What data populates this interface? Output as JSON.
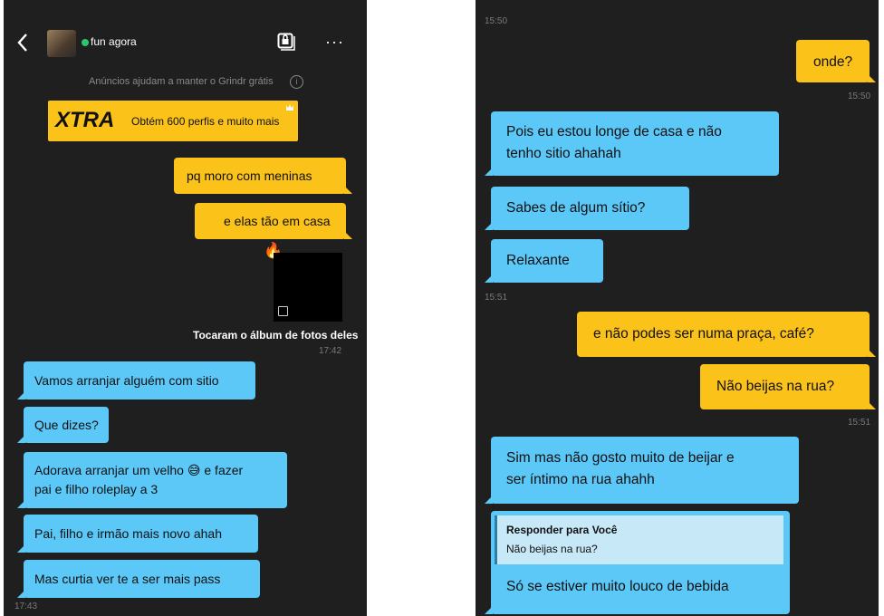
{
  "left": {
    "header": {
      "status": "fun agora"
    },
    "ad_notice": "Anúncios ajudam a manter o Grindr grátis",
    "ad_banner": {
      "brand": "XTRA",
      "text": "Obtém 600 perfis e muito mais"
    },
    "messages": [
      {
        "side": "out",
        "text": "pq moro com meninas"
      },
      {
        "side": "out",
        "text": "e elas tão em casa"
      }
    ],
    "reaction_emoji": "🔥",
    "album_caption": "Tocaram o álbum de fotos deles",
    "time_1": "17:42",
    "incoming": [
      {
        "text": "Vamos arranjar alguém com sitio"
      },
      {
        "text": "Que dizes?"
      },
      {
        "text_a": "Adorava arranjar um velho",
        "emoji": "😅",
        "text_b": "e fazer",
        "text_c": "pai e filho roleplay a 3"
      },
      {
        "text": "Pai, filho e irmão mais novo ahah"
      },
      {
        "text": "Mas curtia ver te a ser mais pass"
      }
    ],
    "time_2": "17:43"
  },
  "right": {
    "time_top": "15:50",
    "msg_onde": "onde?",
    "time_onde": "15:50",
    "in_1_line1": "Pois eu estou longe de casa e não",
    "in_1_line2": "tenho sitio ahahah",
    "in_2": "Sabes de algum sítio?",
    "in_3": "Relaxante",
    "time_in": "15:51",
    "out_1": "e não podes ser numa praça, café?",
    "out_2": "Não beijas na rua?",
    "time_out": "15:51",
    "in_4_line1": "Sim mas não gosto muito de beijar e",
    "in_4_line2": "ser íntimo na rua ahahh",
    "reply": {
      "title": "Responder para Você",
      "quote": "Não beijas na rua?",
      "text": "Só se estiver muito louco de bebida"
    }
  },
  "colors": {
    "incoming": "#5bc8f8",
    "outgoing": "#fbc21a",
    "background": "#1f1f1f",
    "online": "#28c76f"
  },
  "icons": [
    "back-arrow-icon",
    "avatar",
    "online-dot-icon",
    "album-share-icon",
    "more-options-icon",
    "info-icon",
    "crown-icon",
    "album-badge-icon",
    "fire-emoji-icon",
    "sweat-smile-emoji-icon"
  ]
}
